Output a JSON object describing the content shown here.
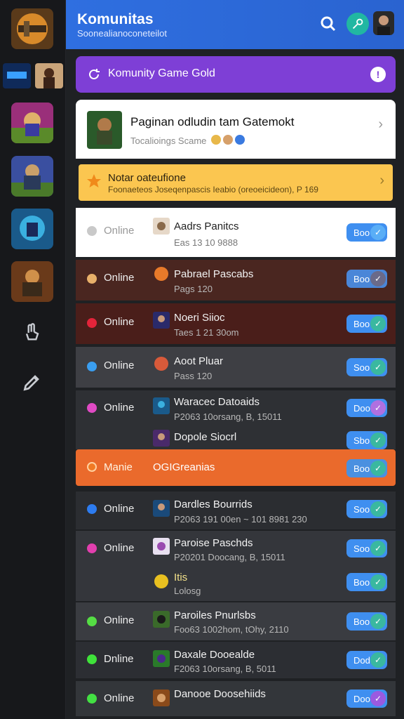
{
  "header": {
    "title": "Komunitas",
    "subtitle": "Soonealianoconeteilot"
  },
  "group_bar": {
    "label": "Komunity Game Gold",
    "info_icon": "info-icon"
  },
  "feature": {
    "title": "Paginan odludin tam Gatemokt",
    "subtitle": "Tocalioings Scame"
  },
  "notice": {
    "title": "Notar oateufione",
    "subtitle": "Foonaeteos Joseqenpascis Ieabio (oreoeicideon), P 169"
  },
  "rows": [
    {
      "status": "Online",
      "name": "Aadrs Panitcs",
      "sub": "Eas 13 10 9888",
      "button": "Boo",
      "dot": "#c9c9c9"
    },
    {
      "status": "Online",
      "name": "Pabrael Pascabs",
      "sub": "Pags 120",
      "button": "Boo",
      "dot": "#e8b06a"
    },
    {
      "status": "Online",
      "name": "Noeri Siioc",
      "sub": "Taes 1 21 30om",
      "button": "Boo",
      "dot": "#e3243a"
    },
    {
      "status": "Online",
      "name": "Aoot Pluar",
      "sub": "Pass 120",
      "button": "Soo",
      "dot": "#3a9ef0"
    },
    {
      "status": "Online",
      "name": "Waracec Datoaids",
      "sub": "P2063 10orsang, B, 15011",
      "button": "Doo",
      "dot": "#e04ac4"
    },
    {
      "status": "",
      "name": "Dopole Siocrl",
      "sub": "",
      "button": "Sbo",
      "dot": ""
    },
    {
      "status": "Manie",
      "name": "OGIGreanias",
      "sub": "",
      "button": "Boo",
      "dot": "#f07a24"
    },
    {
      "status": "Online",
      "name": "Dardles Bourrids",
      "sub": "P2063 191 00en ~ 101 8981 230",
      "button": "Soo",
      "dot": "#2d7cf0"
    },
    {
      "status": "Online",
      "name": "Paroise Paschds",
      "sub": "P20201 Doocang, B, 15011",
      "button": "Soo",
      "dot": "#e23fae"
    },
    {
      "status": "",
      "name": "Itis",
      "sub": "Lolosg",
      "button": "Boo",
      "dot": ""
    },
    {
      "status": "Online",
      "name": "Paroiles Pnurlsbs",
      "sub": "Foo63 1002hom, tOhy, 2110",
      "button": "Boo",
      "dot": "#55dd44"
    },
    {
      "status": "Dnline",
      "name": "Daxale Dooealde",
      "sub": "F2063 10orsang, B, 5011",
      "button": "Dod",
      "dot": "#3fe23a"
    },
    {
      "status": "Online",
      "name": "Danooe Doosehiids",
      "sub": "",
      "button": "Doo",
      "dot": "#43e043"
    }
  ]
}
